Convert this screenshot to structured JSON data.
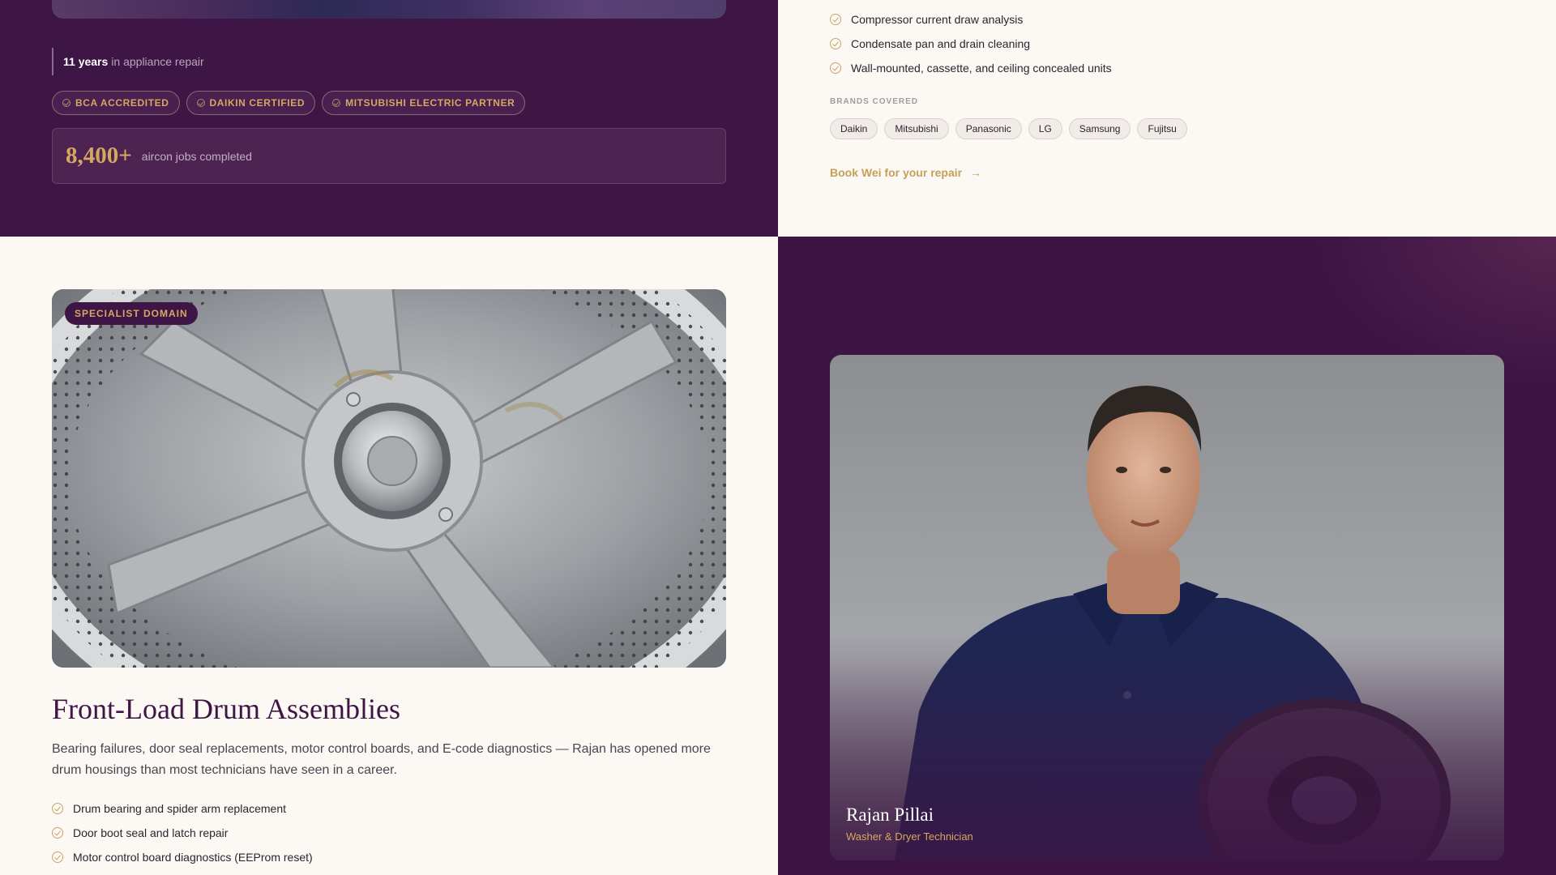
{
  "experience": {
    "years_value": "11 years",
    "years_suffix": "in appliance repair"
  },
  "certifications": [
    "BCA ACCREDITED",
    "DAIKIN CERTIFIED",
    "MITSUBISHI ELECTRIC PARTNER"
  ],
  "stat": {
    "value": "8,400+",
    "label": "aircon jobs completed"
  },
  "aircon_services": [
    "Compressor current draw analysis",
    "Condensate pan and drain cleaning",
    "Wall-mounted, cassette, and ceiling concealed units"
  ],
  "brands": {
    "title": "BRANDS COVERED",
    "items": [
      "Daikin",
      "Mitsubishi",
      "Panasonic",
      "LG",
      "Samsung",
      "Fujitsu"
    ]
  },
  "book_link": {
    "label": "Book Wei for your repair",
    "icon": "arrow-right-icon"
  },
  "specialist": {
    "badge": "SPECIALIST DOMAIN",
    "title": "Front-Load Drum Assemblies",
    "description": "Bearing failures, door seal replacements, motor control boards, and E-code diagnostics — Rajan has opened more drum housings than most technicians have seen in a career.",
    "items": [
      "Drum bearing and spider arm replacement",
      "Door boot seal and latch repair",
      "Motor control board diagnostics (EEProm reset)"
    ]
  },
  "technician": {
    "name": "Rajan Pillai",
    "role": "Washer & Dryer Technician"
  },
  "colors": {
    "plum": "#3e1646",
    "gold": "#d4a860",
    "cream": "#fcf8f4"
  }
}
